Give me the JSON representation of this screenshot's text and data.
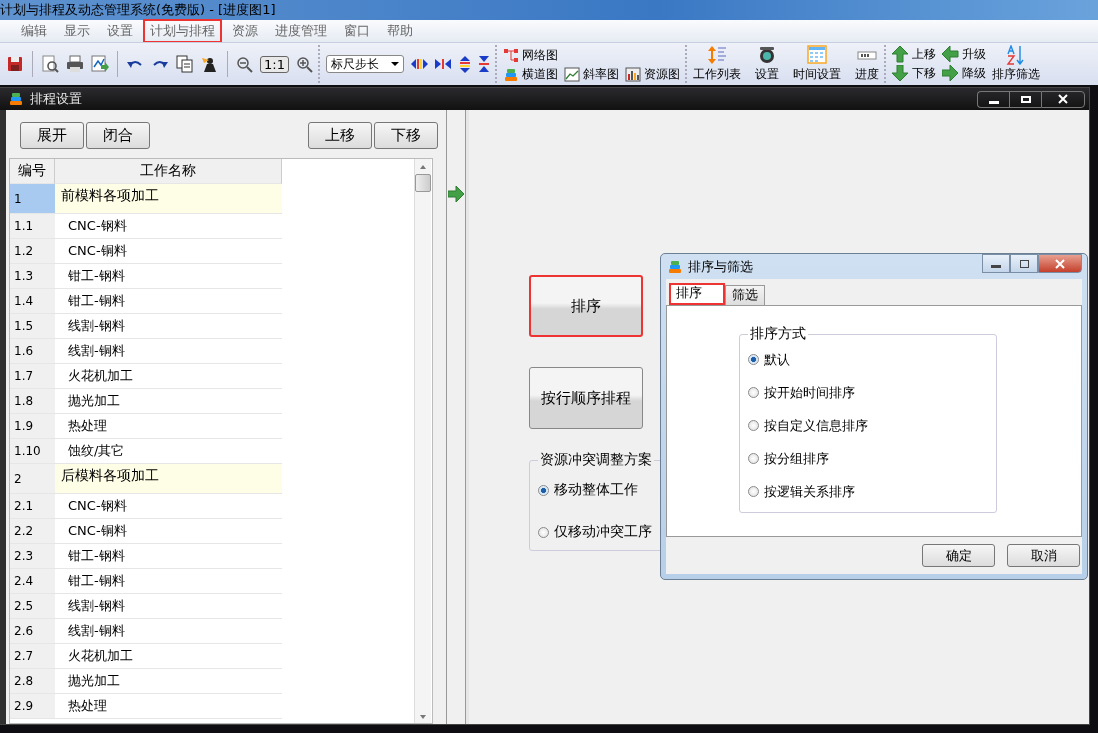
{
  "window": {
    "title": "计划与排程及动态管理系统(免费版) - [进度图1]"
  },
  "menu": [
    {
      "label": "编辑",
      "highlighted": false
    },
    {
      "label": "显示",
      "highlighted": false
    },
    {
      "label": "设置",
      "highlighted": false
    },
    {
      "label": "计划与排程",
      "highlighted": true
    },
    {
      "label": "资源",
      "highlighted": false
    },
    {
      "label": "进度管理",
      "highlighted": false
    },
    {
      "label": "窗口",
      "highlighted": false
    },
    {
      "label": "帮助",
      "highlighted": false
    }
  ],
  "toolbar": {
    "zoom_reset": "1:1",
    "ruler_dropdown": "标尺步长",
    "view_buttons": [
      "网络图",
      "横道图",
      "斜率图",
      "资源图"
    ],
    "tool_buttons": [
      "工作列表",
      "设置",
      "时间设置",
      "进度"
    ],
    "move_buttons": [
      "上移",
      "下移",
      "升级",
      "降级"
    ],
    "sort_button": "排序筛选"
  },
  "child_window": {
    "title": "排程设置",
    "buttons_left": [
      "展开",
      "闭合"
    ],
    "buttons_right": [
      "上移",
      "下移"
    ],
    "columns": [
      "编号",
      "工作名称"
    ],
    "tasks": [
      {
        "number": "1",
        "name": "前模料各项加工",
        "selected": true,
        "children": [
          {
            "number": "1.1",
            "name": "CNC-钢料",
            "selected": false
          },
          {
            "number": "1.2",
            "name": "CNC-铜料",
            "selected": false
          },
          {
            "number": "1.3",
            "name": "钳工-钢料",
            "selected": false
          },
          {
            "number": "1.4",
            "name": "钳工-铜料",
            "selected": false
          },
          {
            "number": "1.5",
            "name": "线割-钢料",
            "selected": false
          },
          {
            "number": "1.6",
            "name": "线割-铜料",
            "selected": false
          },
          {
            "number": "1.7",
            "name": "火花机加工",
            "selected": false
          },
          {
            "number": "1.8",
            "name": "抛光加工",
            "selected": false
          },
          {
            "number": "1.9",
            "name": "热处理",
            "selected": false
          },
          {
            "number": "1.10",
            "name": "蚀纹/其它",
            "selected": false
          }
        ]
      },
      {
        "number": "2",
        "name": "后模料各项加工",
        "selected": false,
        "children": [
          {
            "number": "2.1",
            "name": "CNC-钢料",
            "selected": false
          },
          {
            "number": "2.2",
            "name": "CNC-铜料",
            "selected": false
          },
          {
            "number": "2.3",
            "name": "钳工-钢料",
            "selected": false
          },
          {
            "number": "2.4",
            "name": "钳工-铜料",
            "selected": false
          },
          {
            "number": "2.5",
            "name": "线割-钢料",
            "selected": false
          },
          {
            "number": "2.6",
            "name": "线割-铜料",
            "selected": false
          },
          {
            "number": "2.7",
            "name": "火花机加工",
            "selected": false
          },
          {
            "number": "2.8",
            "name": "抛光加工",
            "selected": false
          },
          {
            "number": "2.9",
            "name": "热处理",
            "selected": false
          }
        ]
      }
    ],
    "actions": [
      {
        "label": "排序",
        "highlighted": true
      },
      {
        "label": "按行顺序排程",
        "highlighted": false
      }
    ],
    "conflict_group": {
      "title": "资源冲突调整方案",
      "options": [
        {
          "label": "移动整体工作",
          "selected": true
        },
        {
          "label": "仅移动冲突工序",
          "selected": false
        }
      ]
    }
  },
  "dialog": {
    "title": "排序与筛选",
    "tabs": [
      {
        "label": "排序",
        "selected": true,
        "highlighted": true
      },
      {
        "label": "筛选",
        "selected": false,
        "highlighted": false
      }
    ],
    "group_title": "排序方式",
    "options": [
      {
        "label": "默认",
        "selected": true
      },
      {
        "label": "按开始时间排序",
        "selected": false
      },
      {
        "label": "按自定义信息排序",
        "selected": false
      },
      {
        "label": "按分组排序",
        "selected": false
      },
      {
        "label": "按逻辑关系排序",
        "selected": false
      }
    ],
    "buttons": [
      "确定",
      "取消"
    ]
  }
}
